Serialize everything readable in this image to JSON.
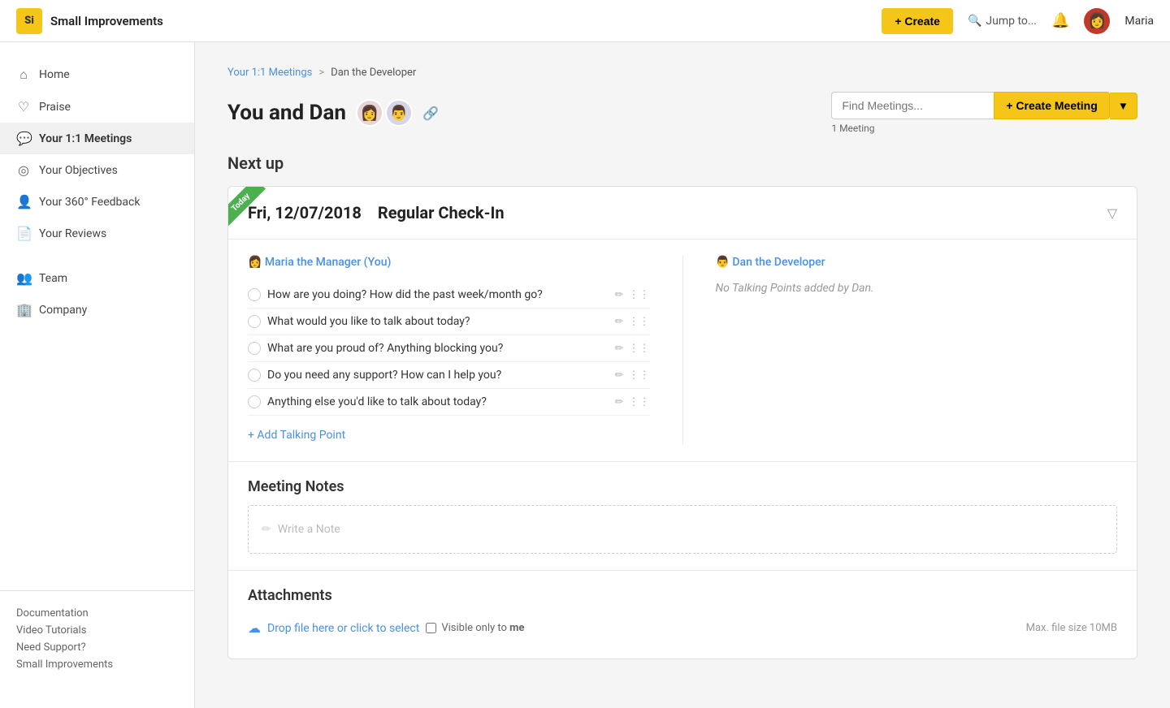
{
  "app": {
    "logo": "Si",
    "name": "Small Improvements"
  },
  "topNav": {
    "create_label": "+ Create",
    "jump_to_label": "Jump to...",
    "user_name": "Maria"
  },
  "sidebar": {
    "items": [
      {
        "id": "home",
        "label": "Home",
        "icon": "⌂",
        "active": false
      },
      {
        "id": "praise",
        "label": "Praise",
        "icon": "♡",
        "active": false
      },
      {
        "id": "meetings",
        "label": "Your 1:1 Meetings",
        "icon": "💬",
        "active": true
      },
      {
        "id": "objectives",
        "label": "Your Objectives",
        "icon": "◎",
        "active": false
      },
      {
        "id": "feedback",
        "label": "Your 360° Feedback",
        "icon": "👤",
        "active": false
      },
      {
        "id": "reviews",
        "label": "Your Reviews",
        "icon": "📄",
        "active": false
      },
      {
        "id": "team",
        "label": "Team",
        "icon": "👥",
        "active": false
      },
      {
        "id": "company",
        "label": "Company",
        "icon": "🏢",
        "active": false
      }
    ],
    "footer_links": [
      "Documentation",
      "Video Tutorials",
      "Need Support?",
      "Small Improvements"
    ]
  },
  "breadcrumb": {
    "parent_label": "Your 1:1 Meetings",
    "separator": ">",
    "current_label": "Dan the Developer"
  },
  "page": {
    "title_prefix": "You and Dan",
    "meeting_count": "1 Meeting"
  },
  "header": {
    "find_placeholder": "Find Meetings...",
    "create_meeting_label": "+ Create Meeting"
  },
  "section": {
    "next_up_label": "Next up"
  },
  "meeting": {
    "today_badge": "Today",
    "date": "Fri, 12/07/2018",
    "type": "Regular Check-In",
    "left_column": {
      "header": "Maria the Manager (You)",
      "talking_points": [
        "How are you doing? How did the past week/month go?",
        "What would you like to talk about today?",
        "What are you proud of? Anything blocking you?",
        "Do you need any support? How can I help you?",
        "Anything else you'd like to talk about today?"
      ],
      "add_label": "+ Add Talking Point"
    },
    "right_column": {
      "header": "Dan the Developer",
      "no_points_text": "No Talking Points added by Dan."
    },
    "notes": {
      "title": "Meeting Notes",
      "placeholder": "Write a Note"
    },
    "attachments": {
      "title": "Attachments",
      "drop_text": "Drop file here or click to select",
      "visible_label": "Visible only to",
      "visible_me": "me",
      "file_size_label": "Max. file size 10MB"
    }
  }
}
